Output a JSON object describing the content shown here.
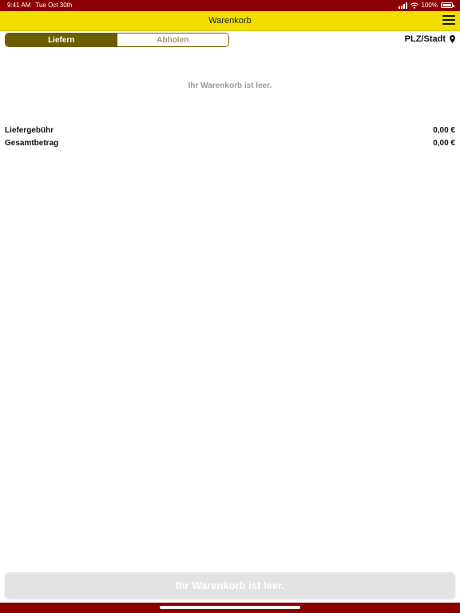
{
  "status_bar": {
    "time": "9:41 AM",
    "date": "Tue Oct 30th",
    "battery": "100%"
  },
  "nav": {
    "title": "Warenkorb",
    "menu_icon": "hamburger-menu-icon"
  },
  "mode_tabs": [
    {
      "label": "Liefern",
      "selected": true
    },
    {
      "label": "Abholen",
      "selected": false
    }
  ],
  "location": {
    "label": "PLZ/Stadt",
    "icon": "location-pin-icon"
  },
  "cart": {
    "empty_message": "Ihr Warenkorb ist leer."
  },
  "summary": {
    "fee_label": "Liefergebühr",
    "fee_value": "0,00 €",
    "total_label": "Gesamtbetrag",
    "total_value": "0,00 €"
  },
  "checkout": {
    "label": "Ihr Warenkorb ist leer."
  },
  "colors": {
    "status_bar": "#8b0000",
    "nav_bar": "#f1de00",
    "segment_active": "#6b5e00",
    "disabled_button": "#e3e3e3"
  }
}
